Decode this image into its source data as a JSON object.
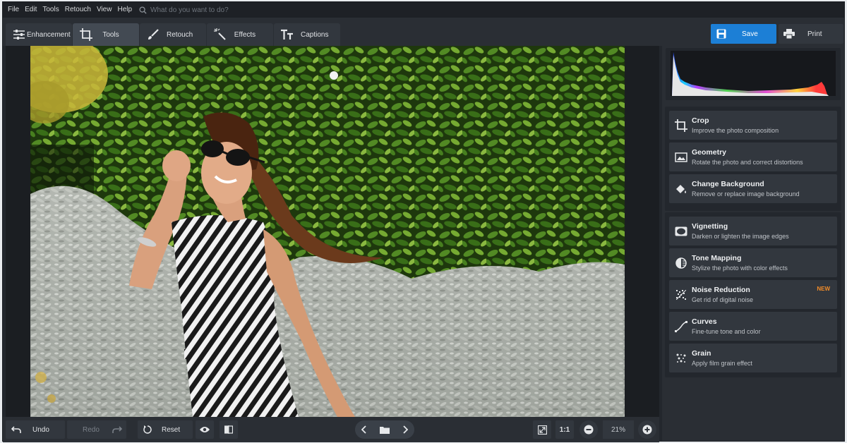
{
  "menu": [
    "File",
    "Edit",
    "Tools",
    "Retouch",
    "View",
    "Help"
  ],
  "search": {
    "placeholder": "What do you want to do?"
  },
  "tabs": [
    {
      "label": "Enhancement",
      "icon": "sliders-icon"
    },
    {
      "label": "Tools",
      "icon": "crop-icon"
    },
    {
      "label": "Retouch",
      "icon": "brush-icon"
    },
    {
      "label": "Effects",
      "icon": "magic-wand-icon"
    },
    {
      "label": "Captions",
      "icon": "text-icon"
    }
  ],
  "save_label": "Save",
  "print_label": "Print",
  "tools_group1": [
    {
      "title": "Crop",
      "subtitle": "Improve the photo composition",
      "icon": "crop-icon"
    },
    {
      "title": "Geometry",
      "subtitle": "Rotate the photo and correct distortions",
      "icon": "geometry-icon"
    },
    {
      "title": "Change Background",
      "subtitle": "Remove or replace image background",
      "icon": "paint-bucket-icon"
    }
  ],
  "tools_group2": [
    {
      "title": "Vignetting",
      "subtitle": "Darken or lighten the image edges",
      "icon": "vignette-icon"
    },
    {
      "title": "Tone Mapping",
      "subtitle": "Stylize the photo with color effects",
      "icon": "tone-icon"
    },
    {
      "title": "Noise Reduction",
      "subtitle": "Get rid of digital noise",
      "icon": "noise-icon",
      "badge": "NEW"
    },
    {
      "title": "Curves",
      "subtitle": "Fine-tune tone and color",
      "icon": "curves-icon"
    },
    {
      "title": "Grain",
      "subtitle": "Apply film grain effect",
      "icon": "grain-icon"
    }
  ],
  "bottom": {
    "undo": "Undo",
    "redo": "Redo",
    "reset": "Reset",
    "one_to_one": "1:1",
    "zoom": "21%"
  },
  "colors": {
    "accent": "#1c7fd6",
    "badge": "#f28c28"
  }
}
